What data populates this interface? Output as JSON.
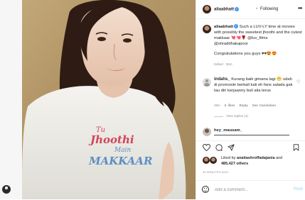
{
  "header": {
    "username": "aliaabhatt",
    "separator": "•",
    "follow_status": "Following",
    "more": "•••"
  },
  "caption": {
    "username": "aliaabhatt",
    "text": " Such a LUV-LY time at movies with possibly the sweetest jhoothi and the cutest makkaar 💘💘🌹 @luv_films @shraddhakapoor",
    "second_line": "Congratulations you guys ♥♥😍😍",
    "edited": "Edited · 35m"
  },
  "comment": {
    "username": "indahs_",
    "text": " Kurang baik gimana lagi 😁 udah di promosiin berkali kali eh fans salada gak tau diri kerjaanny buli alia terus",
    "age": "28m",
    "likes": "6 likes",
    "reply": "Reply",
    "translate": "See translation",
    "view_replies": "View replies (4)"
  },
  "reply_typing": {
    "username": "hey_mausam_"
  },
  "likes": {
    "prefix": "Liked by ",
    "first_user": "anaitashroffadajania",
    "joiner": " and",
    "others": "485,427 others"
  },
  "time_ago": "40 MINUTES AGO",
  "add_comment": {
    "placeholder": "Add a comment...",
    "post_label": "Post"
  },
  "photo": {
    "shirt_line1": "Tu",
    "shirt_line2": "Jhoothi",
    "shirt_line3": "Main",
    "shirt_line4": "MAKKAAR"
  },
  "colors": {
    "verified": "#3897f0",
    "post_disabled": "#b2dffc",
    "muted_text": "#8e8e8e",
    "shirt_red": "#d0455a",
    "shirt_blue": "#5b8fc4"
  },
  "icons": [
    "heart-icon",
    "comment-icon",
    "share-icon",
    "bookmark-icon",
    "emoji-icon",
    "more-icon",
    "verified-icon"
  ]
}
